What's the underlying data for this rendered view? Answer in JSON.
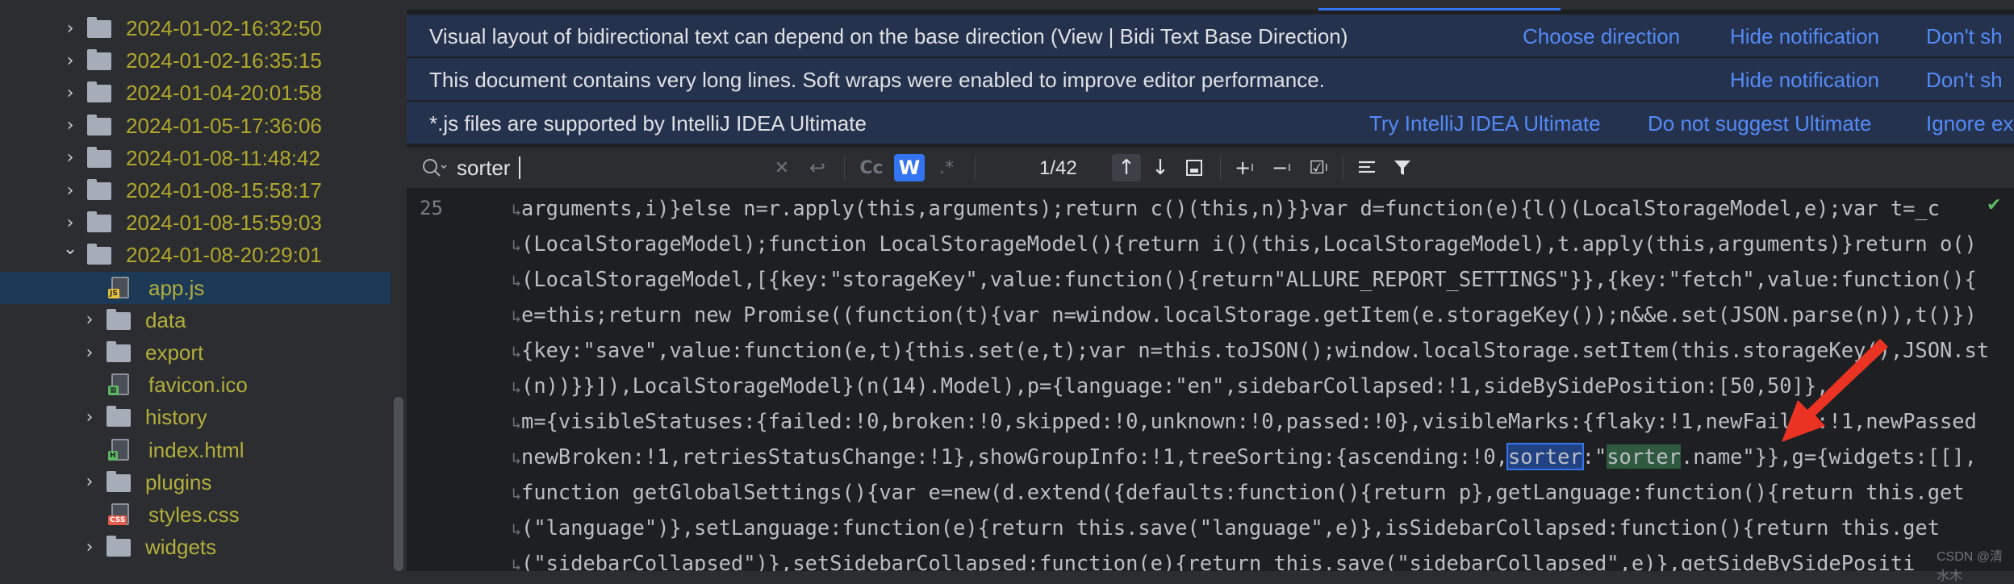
{
  "tree": {
    "rows": [
      {
        "label": "2024-01-02-16:32:50",
        "kind": "folder",
        "expanded": false
      },
      {
        "label": "2024-01-02-16:35:15",
        "kind": "folder",
        "expanded": false
      },
      {
        "label": "2024-01-04-20:01:58",
        "kind": "folder",
        "expanded": false
      },
      {
        "label": "2024-01-05-17:36:06",
        "kind": "folder",
        "expanded": false
      },
      {
        "label": "2024-01-08-11:48:42",
        "kind": "folder",
        "expanded": false
      },
      {
        "label": "2024-01-08-15:58:17",
        "kind": "folder",
        "expanded": false
      },
      {
        "label": "2024-01-08-15:59:03",
        "kind": "folder",
        "expanded": false
      },
      {
        "label": "2024-01-08-20:29:01",
        "kind": "folder",
        "expanded": true
      },
      {
        "label": "app.js",
        "kind": "js",
        "selected": true
      },
      {
        "label": "data",
        "kind": "folder",
        "expanded": false
      },
      {
        "label": "export",
        "kind": "folder",
        "expanded": false
      },
      {
        "label": "favicon.ico",
        "kind": "ico"
      },
      {
        "label": "history",
        "kind": "folder",
        "expanded": false
      },
      {
        "label": "index.html",
        "kind": "html"
      },
      {
        "label": "plugins",
        "kind": "folder",
        "expanded": false
      },
      {
        "label": "styles.css",
        "kind": "css"
      },
      {
        "label": "widgets",
        "kind": "folder",
        "expanded": false
      }
    ]
  },
  "banners": [
    {
      "message": "Visual layout of bidirectional text can depend on the base direction (View | Bidi Text Base Direction)",
      "actions": [
        "Choose direction",
        "Hide notification",
        "Don't sh"
      ]
    },
    {
      "message": "This document contains very long lines. Soft wraps were enabled to improve editor performance.",
      "actions": [
        "Hide notification",
        "Don't sh"
      ]
    },
    {
      "message": "*.js files are supported by IntelliJ IDEA Ultimate",
      "actions": [
        "Try IntelliJ IDEA Ultimate",
        "Do not suggest Ultimate",
        "Ignore ex"
      ]
    }
  ],
  "find": {
    "query": "sorter",
    "match_case": "Cc",
    "words": "W",
    "regex": ".*",
    "count": "1/42",
    "words_enabled": true
  },
  "editor": {
    "line_number": "25",
    "lines": [
      "arguments,i)}else n=r.apply(this,arguments);return c()(this,n)}}var d=function(e){l()(LocalStorageModel,e);var t=_c",
      "(LocalStorageModel);function LocalStorageModel(){return i()(this,LocalStorageModel),t.apply(this,arguments)}return o()",
      "(LocalStorageModel,[{key:\"storageKey\",value:function(){return\"ALLURE_REPORT_SETTINGS\"}},{key:\"fetch\",value:function(){",
      "e=this;return new Promise((function(t){var n=window.localStorage.getItem(e.storageKey());n&&e.set(JSON.parse(n)),t()})",
      "{key:\"save\",value:function(e,t){this.set(e,t);var n=this.toJSON();window.localStorage.setItem(this.storageKey(),JSON.st",
      "(n))}}]),LocalStorageModel}(n(14).Model),p={language:\"en\",sidebarCollapsed:!1,sideBySidePosition:[50,50]},",
      "m={visibleStatuses:{failed:!0,broken:!0,skipped:!0,unknown:!0,passed:!0},visibleMarks:{flaky:!1,newFailed:!1,newPassed",
      "newBroken:!1,retriesStatusChange:!1},showGroupInfo:!1,treeSorting:{ascending:!0,",
      "function getGlobalSettings(){var e=new(d.extend({defaults:function(){return p},getLanguage:function(){return this.get",
      "(\"language\")},setLanguage:function(e){return this.save(\"language\",e)},isSidebarCollapsed:function(){return this.get",
      "(\"sidebarCollapsed\")},setSidebarCollapsed:function(e){return this.save(\"sidebarCollapsed\",e)},getSideBySidePositi"
    ],
    "match_line": {
      "before": "newBroken:!1,retriesStatusChange:!1},showGroupInfo:!1,treeSorting:{ascending:!0,",
      "current_match": "sorter",
      "middle": ":\"",
      "other_match": "sorter",
      "after": ".name\"}},g={widgets:[[],"
    }
  },
  "colors": {
    "accent": "#3574f0",
    "link": "#548af7",
    "tree_text": "#b1a72b",
    "annotation_arrow": "#ea3323"
  },
  "watermark": "CSDN @清水木"
}
